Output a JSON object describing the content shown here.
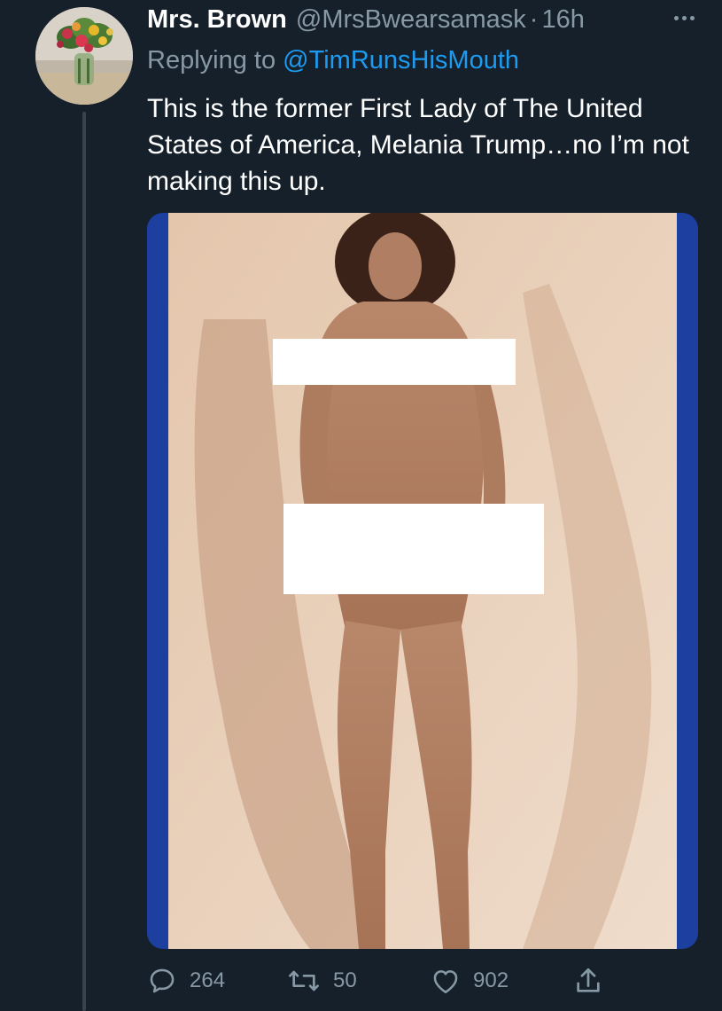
{
  "tweet": {
    "display_name": "Mrs. Brown",
    "handle": "@MrsBwearsamask",
    "separator": "·",
    "time": "16h",
    "replying_prefix": "Replying to",
    "replying_to": "@TimRunsHisMouth",
    "text": "This is the former First Lady of The United States of America, Melania Trump…no I’m not making this up."
  },
  "actions": {
    "reply_count": "264",
    "retweet_count": "50",
    "like_count": "902"
  },
  "icons": {
    "more": "more-horizontal-icon",
    "reply": "speech-bubble-icon",
    "retweet": "retweet-arrows-icon",
    "like": "heart-icon",
    "share": "share-upload-icon"
  },
  "colors": {
    "background": "#15202b",
    "secondary_text": "#8899a6",
    "link": "#1d9bf0",
    "thread_line": "#38444d",
    "media_border": "#1c3fa0"
  }
}
